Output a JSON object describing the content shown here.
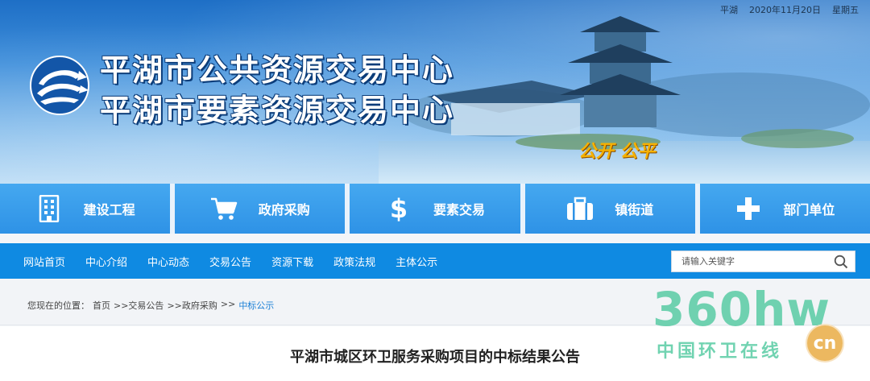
{
  "header": {
    "date_bar": {
      "city": "平湖",
      "date": "2020年11月20日",
      "weekday": "星期五"
    },
    "title_main": "平湖市公共资源交易中心",
    "title_sub": "平湖市要素资源交易中心",
    "slogan": "公开  公平"
  },
  "tiles": [
    {
      "label": "建设工程",
      "icon": "building-icon"
    },
    {
      "label": "政府采购",
      "icon": "shopping-cart-icon"
    },
    {
      "label": "要素交易",
      "icon": "dollar-icon"
    },
    {
      "label": "镇街道",
      "icon": "briefcase-icon"
    },
    {
      "label": "部门单位",
      "icon": "plus-icon"
    }
  ],
  "nav": {
    "links": [
      "网站首页",
      "中心介绍",
      "中心动态",
      "交易公告",
      "资源下载",
      "政策法规",
      "主体公示"
    ],
    "search_placeholder": "请输入关键字"
  },
  "breadcrumb": {
    "prefix": "您现在的位置：",
    "items": [
      "首页",
      ">>交易公告",
      ">>政府采购",
      ">>",
      "中标公示"
    ]
  },
  "article": {
    "title": "平湖市城区环卫服务采购项目的中标结果公告"
  },
  "watermark": {
    "main": "360hw",
    "sub": "中国环卫在线",
    "badge": "cn"
  },
  "colors": {
    "nav_bg": "#0f8ae2",
    "tile_bg": "#2e92e6",
    "breadcrumb_current": "#1a7fd6",
    "slogan": "#f6b100",
    "watermark": "#52c9a0"
  }
}
